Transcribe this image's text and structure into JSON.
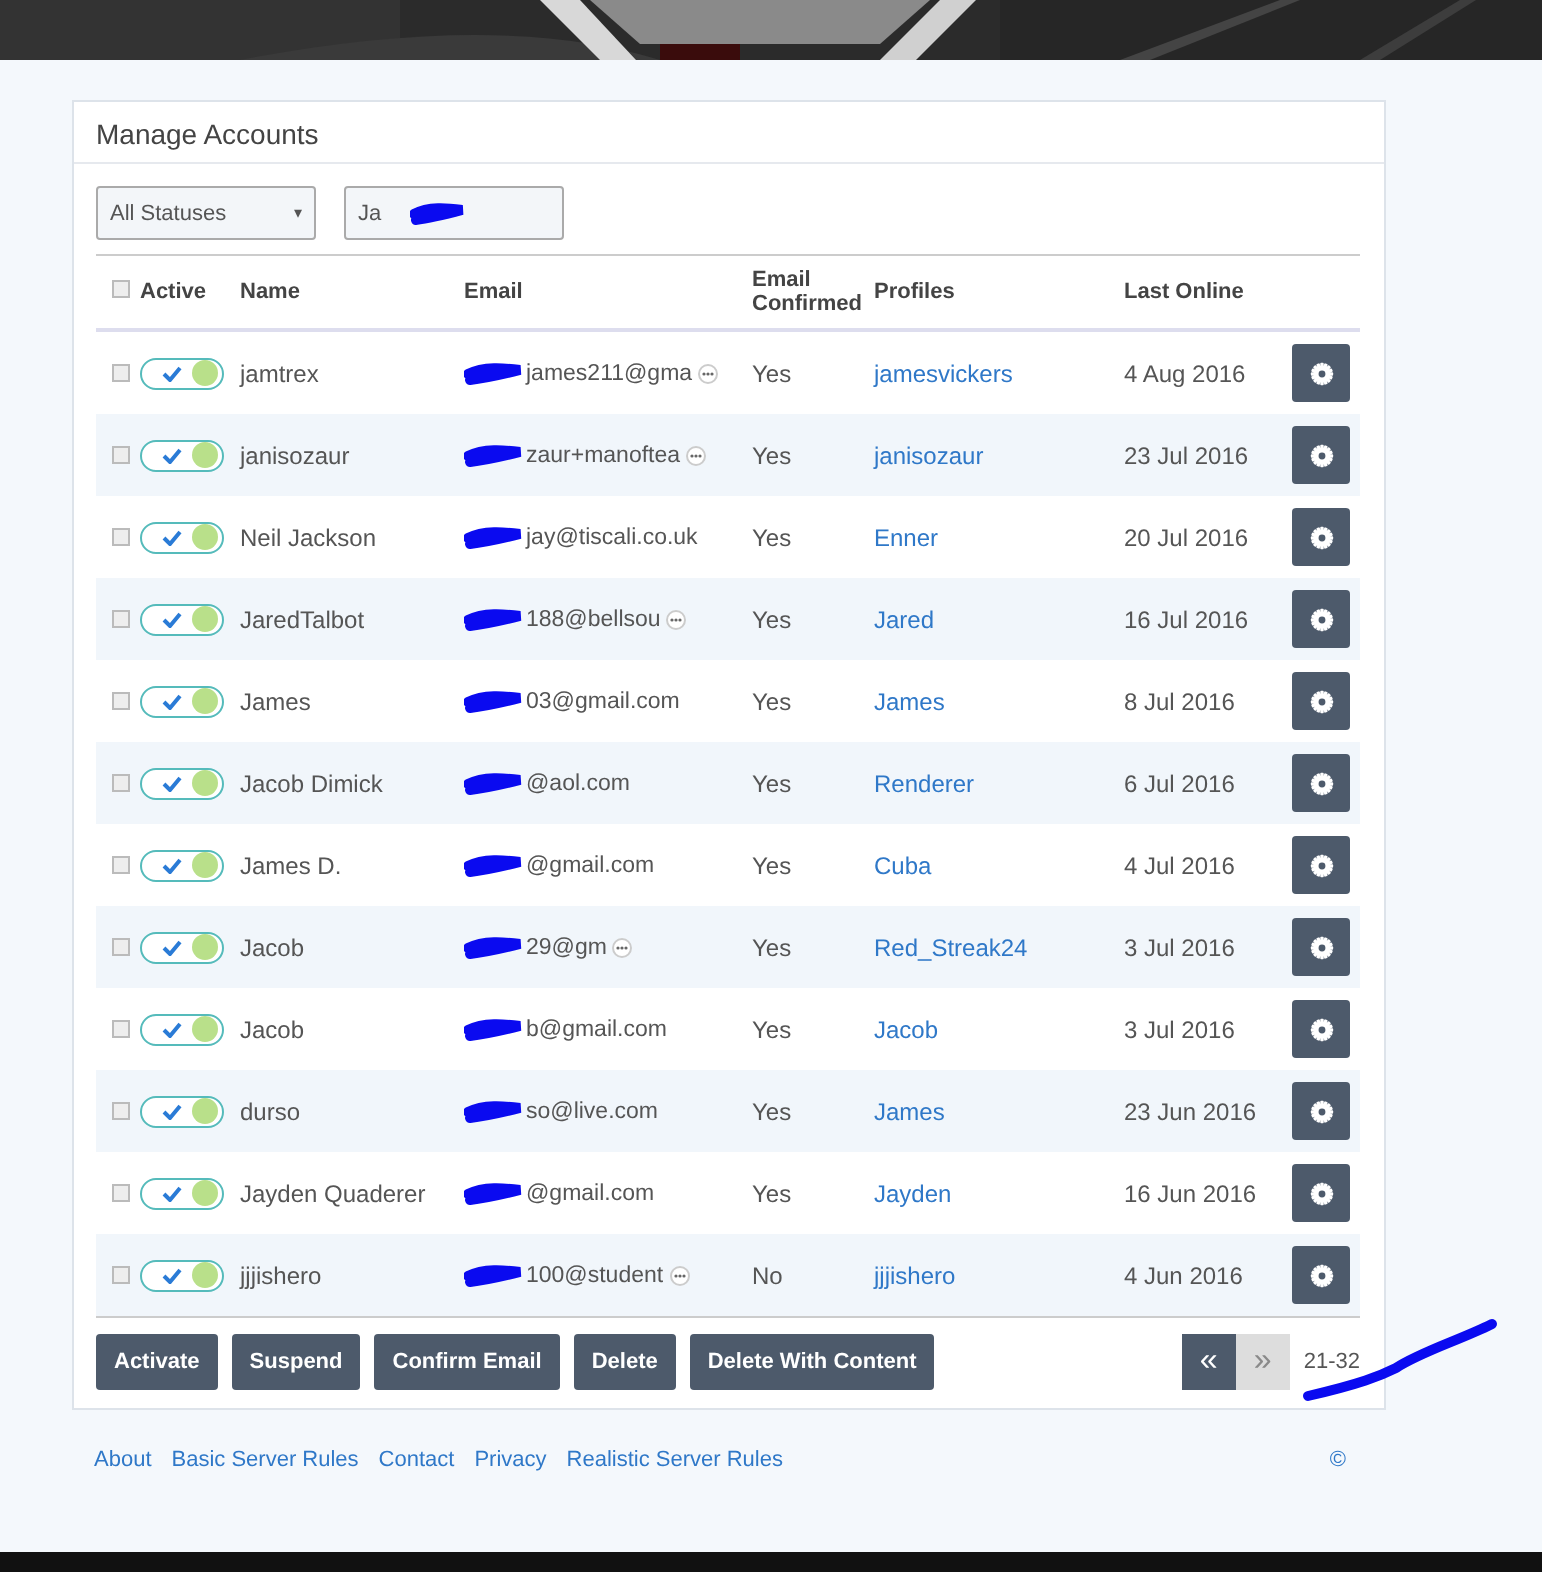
{
  "panel": {
    "title": "Manage Accounts"
  },
  "filters": {
    "status": {
      "value": "All Statuses",
      "caret": "▾"
    },
    "search": {
      "value": "Ja",
      "redacted": true
    }
  },
  "table": {
    "header_checkbox": {
      "checked": false
    },
    "columns": [
      "Active",
      "Name",
      "Email",
      "Email Confirmed",
      "Profiles",
      "Last Online"
    ],
    "rows": [
      {
        "checked": false,
        "active": true,
        "name": "jamtrex",
        "email": {
          "text": "james211@gma",
          "redacted": true,
          "truncated": true
        },
        "confirmed": "Yes",
        "profile": "jamesvickers",
        "last_online": "4 Aug 2016"
      },
      {
        "checked": false,
        "active": true,
        "name": "janisozaur",
        "email": {
          "text": "zaur+manoftea",
          "redacted": true,
          "truncated": true
        },
        "confirmed": "Yes",
        "profile": "janisozaur",
        "last_online": "23 Jul 2016"
      },
      {
        "checked": false,
        "active": true,
        "name": "Neil Jackson",
        "email": {
          "text": "jay@tiscali.co.uk",
          "redacted": true,
          "truncated": false
        },
        "confirmed": "Yes",
        "profile": "Enner",
        "last_online": "20 Jul 2016"
      },
      {
        "checked": false,
        "active": true,
        "name": "JaredTalbot",
        "email": {
          "text": "188@bellsou",
          "redacted": true,
          "truncated": true
        },
        "confirmed": "Yes",
        "profile": "Jared",
        "last_online": "16 Jul 2016"
      },
      {
        "checked": false,
        "active": true,
        "name": "James",
        "email": {
          "text": "03@gmail.com",
          "redacted": true,
          "truncated": false
        },
        "confirmed": "Yes",
        "profile": "James",
        "last_online": "8 Jul 2016"
      },
      {
        "checked": false,
        "active": true,
        "name": "Jacob Dimick",
        "email": {
          "text": "@aol.com",
          "redacted": true,
          "truncated": false
        },
        "confirmed": "Yes",
        "profile": "Renderer",
        "last_online": "6 Jul 2016"
      },
      {
        "checked": false,
        "active": true,
        "name": "James D.",
        "email": {
          "text": "@gmail.com",
          "redacted": true,
          "truncated": false
        },
        "confirmed": "Yes",
        "profile": "Cuba",
        "last_online": "4 Jul 2016"
      },
      {
        "checked": false,
        "active": true,
        "name": "Jacob",
        "email": {
          "text": "29@gm",
          "redacted": true,
          "truncated": true
        },
        "confirmed": "Yes",
        "profile": "Red_Streak24",
        "last_online": "3 Jul 2016"
      },
      {
        "checked": false,
        "active": true,
        "name": "Jacob",
        "email": {
          "text": "b@gmail.com",
          "redacted": true,
          "truncated": false
        },
        "confirmed": "Yes",
        "profile": "Jacob",
        "last_online": "3 Jul 2016"
      },
      {
        "checked": false,
        "active": true,
        "name": "durso",
        "email": {
          "text": "so@live.com",
          "redacted": true,
          "truncated": false
        },
        "confirmed": "Yes",
        "profile": "James",
        "last_online": "23 Jun 2016"
      },
      {
        "checked": false,
        "active": true,
        "name": "Jayden Quaderer",
        "email": {
          "text": "@gmail.com",
          "redacted": true,
          "truncated": false
        },
        "confirmed": "Yes",
        "profile": "Jayden",
        "last_online": "16 Jun 2016"
      },
      {
        "checked": false,
        "active": true,
        "name": "jjjishero",
        "email": {
          "text": "100@student",
          "redacted": true,
          "truncated": true
        },
        "confirmed": "No",
        "profile": "jjjishero",
        "last_online": "4 Jun 2016"
      }
    ]
  },
  "actions": [
    "Activate",
    "Suspend",
    "Confirm Email",
    "Delete",
    "Delete With Content"
  ],
  "pagination": {
    "prev": {
      "label": "«",
      "disabled": false
    },
    "next": {
      "label": "»",
      "disabled": true
    },
    "range": "21-32",
    "redacted": true
  },
  "footer": {
    "links": [
      "About",
      "Basic Server Rules",
      "Contact",
      "Privacy",
      "Realistic Server Rules"
    ],
    "copyright": "©"
  }
}
